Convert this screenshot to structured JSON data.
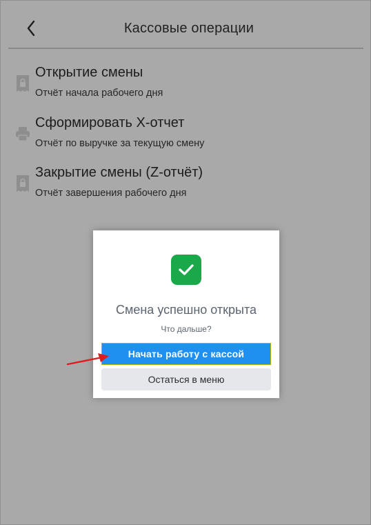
{
  "header": {
    "title": "Кассовые операции",
    "back_icon": "chevron-left-icon"
  },
  "menu": {
    "items": [
      {
        "title": "Открытие смены",
        "subtitle": "Отчёт начала рабочего дня",
        "icon": "receipt-lock-icon"
      },
      {
        "title": "Сформировать Х-отчет",
        "subtitle": "Отчёт по выручке за текущую смену",
        "icon": "printer-icon"
      },
      {
        "title": "Закрытие смены (Z-отчёт)",
        "subtitle": "Отчёт завершения рабочего дня",
        "icon": "receipt-lock-icon"
      }
    ]
  },
  "modal": {
    "icon": "checkmark-icon",
    "title": "Смена успешно открыта",
    "subtitle": "Что дальше?",
    "primary_button": "Начать работу с кассой",
    "secondary_button": "Остаться в меню"
  },
  "colors": {
    "overlay_background": "#a9a9a9",
    "success_green": "#1aa84a",
    "primary_blue": "#1f8ff0",
    "secondary_gray": "#e5e7eb",
    "annotation_red": "#e01b1b"
  }
}
